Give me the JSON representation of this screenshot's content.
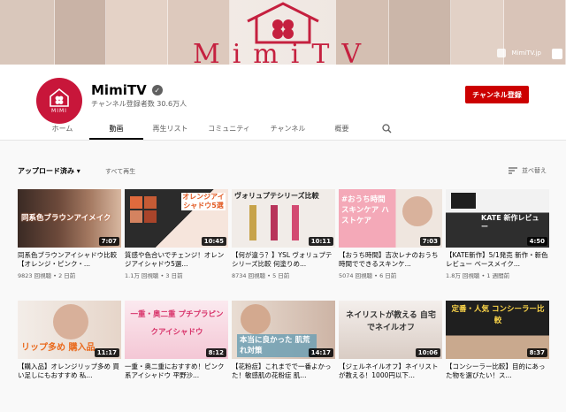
{
  "banner": {
    "logo_text": "MimiTV",
    "site": "MimiTV.jp"
  },
  "channel": {
    "name": "MimiTV",
    "avatar_text": "MIMI",
    "subscribers": "チャンネル登録者数 30.6万人",
    "subscribe_label": "チャンネル登録",
    "brand_color": "#cc0000"
  },
  "tabs": [
    "ホーム",
    "動画",
    "再生リスト",
    "コミュニティ",
    "チャンネル",
    "概要"
  ],
  "controls": {
    "sort": "アップロード済み",
    "play_all": "すべて再生",
    "sort_by": "並べ替え"
  },
  "videos": [
    {
      "thumb_text": "同系色ブラウンアイメイク",
      "duration": "7:07",
      "title": "同系色ブラウンアイシャドウ比較【オレンジ・ピンク・...",
      "views": "9823 回視聴",
      "age": "2 日前"
    },
    {
      "thumb_text": "オレンジアイシャドウ5選",
      "duration": "10:45",
      "title": "質感や色合いでチェンジ！オレンジアイシャドウ5選...",
      "views": "1.1万 回視聴",
      "age": "3 日前"
    },
    {
      "thumb_text": "ヴォリュプテシリーズ比較",
      "duration": "10:11",
      "title": "【何が違う？】YSL ヴォリュプテシリーズ比較 何塗りめ...",
      "views": "8734 回視聴",
      "age": "5 日前"
    },
    {
      "thumb_text": "#おうち時間 スキンケア ハストケア",
      "duration": "7:03",
      "title": "【おうち時間】吉次レナのおうち時間でできるスキンケ...",
      "views": "5074 回視聴",
      "age": "6 日前"
    },
    {
      "thumb_text": "KATE 新作レビュー",
      "duration": "4:50",
      "title": "【KATE新作】5/1発売 新作・新色レビュー ベースメイク...",
      "views": "1.8万 回視聴",
      "age": "1 週間前"
    },
    {
      "thumb_text": "リップ多め 購入品",
      "duration": "11:17",
      "title": "【購入品】オレンジリップ多め 買い足しにもおすすめ 私...",
      "views": "",
      "age": ""
    },
    {
      "thumb_text": "一重・奥二重 プチプラピンクアイシャドウ",
      "duration": "8:12",
      "title": "一重・奥二重におすすめ！ピンク系アイシャドウ 平野沙...",
      "views": "",
      "age": ""
    },
    {
      "thumb_text": "本当に良かった 肌荒れ対策",
      "duration": "14:17",
      "title": "【花粉症】これまでで一番よかった！敏感肌の花粉症 肌...",
      "views": "",
      "age": ""
    },
    {
      "thumb_text": "ネイリストが教える 自宅でネイルオフ",
      "duration": "10:06",
      "title": "【ジェルネイルオフ】ネイリストが教える！1000円以下...",
      "views": "",
      "age": ""
    },
    {
      "thumb_text": "定番・人気 コンシーラー比較",
      "duration": "8:37",
      "title": "【コンシーラー比較】目的にあった物を選びたい！ス...",
      "views": "",
      "age": ""
    }
  ]
}
